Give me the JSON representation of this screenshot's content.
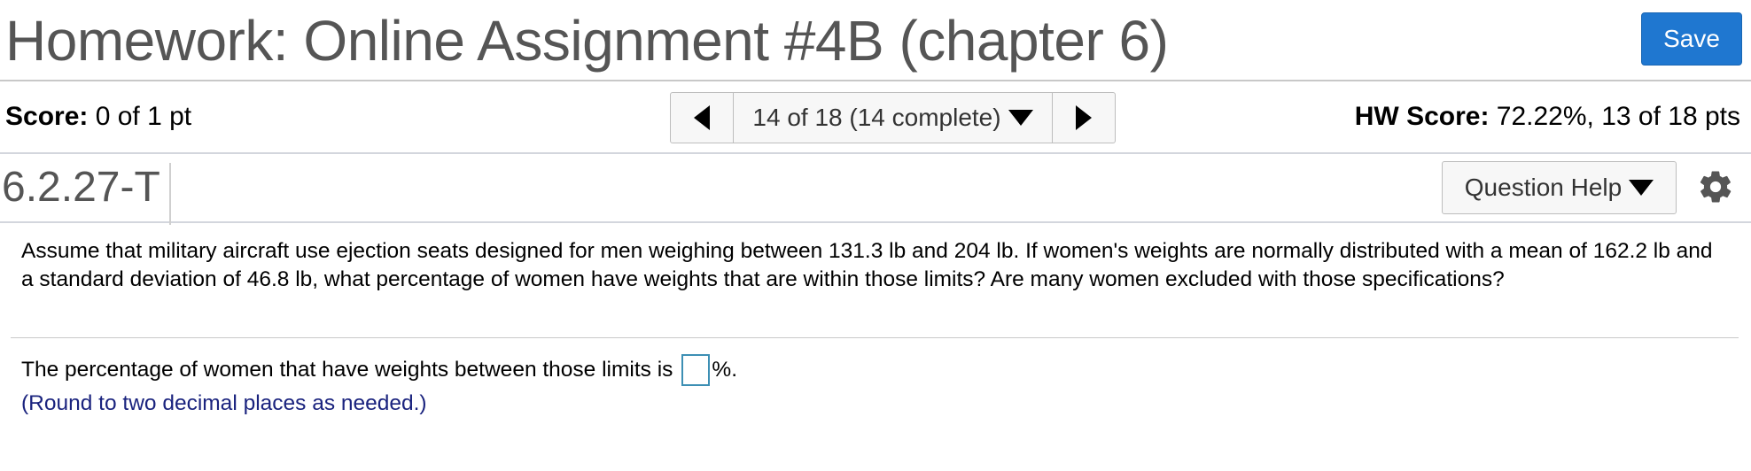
{
  "header": {
    "title": "Homework: Online Assignment #4B (chapter 6)",
    "save_label": "Save"
  },
  "score": {
    "label": "Score:",
    "value": "0 of 1 pt",
    "hw_label": "HW Score:",
    "hw_value": "72.22%, 13 of 18 pts"
  },
  "nav": {
    "position_label": "14 of 18 (14 complete)"
  },
  "question": {
    "id": "6.2.27-T",
    "help_label": "Question Help",
    "text": "Assume that military aircraft use ejection seats designed for men weighing between 131.3 lb and 204 lb. If women's weights are normally distributed with a mean of 162.2 lb and a standard deviation of 46.8 lb, what percentage of women have weights that are within those limits? Are many women excluded with those specifications?",
    "answer_prefix": "The percentage of women that have weights between those limits is",
    "answer_value": "",
    "answer_suffix": "%.",
    "hint": "(Round to two decimal places as needed.)"
  },
  "colors": {
    "save_button": "#1f77d0",
    "title_text": "#555555",
    "hint_text": "#1a237e",
    "answer_box_border": "#3d8fb4"
  }
}
